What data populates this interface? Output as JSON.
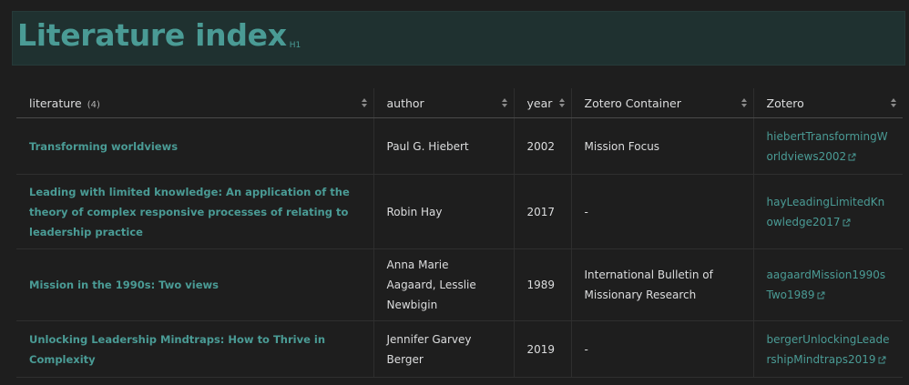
{
  "header": {
    "title": "Literature index",
    "badge": "H1"
  },
  "table": {
    "columns": [
      {
        "label": "literature",
        "count": "(4)"
      },
      {
        "label": "author"
      },
      {
        "label": "year"
      },
      {
        "label": "Zotero Container"
      },
      {
        "label": "Zotero"
      }
    ],
    "rows": [
      {
        "literature": "Transforming worldviews",
        "author": "Paul G. Hiebert",
        "year": "2002",
        "container": "Mission Focus",
        "zotero": "hiebertTransformingWorldviews2002"
      },
      {
        "literature": "Leading with limited knowledge: An application of the theory of complex responsive processes of relating to leadership practice",
        "author": "Robin Hay",
        "year": "2017",
        "container": "-",
        "zotero": "hayLeadingLimitedKnowledge2017"
      },
      {
        "literature": "Mission in the 1990s: Two views",
        "author": "Anna Marie Aagaard, Lesslie Newbigin",
        "year": "1989",
        "container": "International Bulletin of Missionary Research",
        "zotero": "aagaardMission1990sTwo1989"
      },
      {
        "literature": "Unlocking Leadership Mindtraps: How to Thrive in Complexity",
        "author": "Jennifer Garvey Berger",
        "year": "2019",
        "container": "-",
        "zotero": "bergerUnlockingLeadershipMindtraps2019"
      }
    ]
  },
  "icons": {
    "sort": "sort-icon",
    "external_link": "external-link-icon"
  },
  "colors": {
    "background": "#1e1e1e",
    "accent": "#4a9b95",
    "heading_bar": "#1f3130",
    "text": "#dcddde"
  }
}
